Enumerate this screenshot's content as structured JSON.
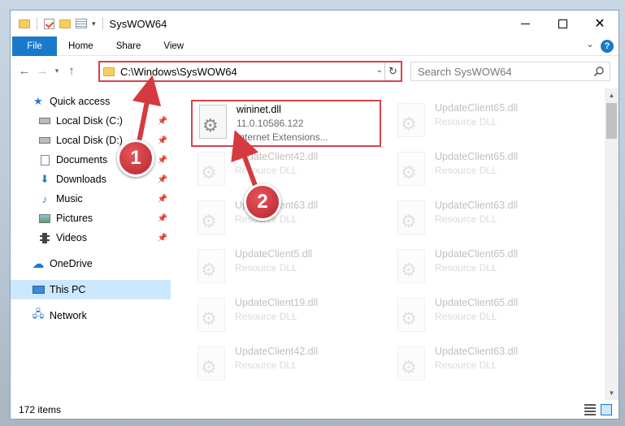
{
  "window": {
    "title": "SysWOW64"
  },
  "ribbon": {
    "tabs": [
      "File",
      "Home",
      "Share",
      "View"
    ]
  },
  "address": {
    "path": "C:\\Windows\\SysWOW64"
  },
  "search": {
    "placeholder": "Search SysWOW64"
  },
  "sidebar": {
    "items": [
      {
        "label": "Quick access",
        "icon": "star-icon"
      },
      {
        "label": "Local Disk (C:)",
        "icon": "drive-icon"
      },
      {
        "label": "Local Disk (D:)",
        "icon": "drive-icon"
      },
      {
        "label": "Documents",
        "icon": "documents-icon"
      },
      {
        "label": "Downloads",
        "icon": "download-icon"
      },
      {
        "label": "Music",
        "icon": "music-icon"
      },
      {
        "label": "Pictures",
        "icon": "pictures-icon"
      },
      {
        "label": "Videos",
        "icon": "videos-icon"
      },
      {
        "label": "OneDrive",
        "icon": "cloud-icon"
      },
      {
        "label": "This PC",
        "icon": "computer-icon"
      },
      {
        "label": "Network",
        "icon": "network-icon"
      }
    ]
  },
  "files": [
    {
      "name": "wininet.dll",
      "version": "11.0.10586.122",
      "type": "Internet Extensions...",
      "highlighted": true
    },
    {
      "name": "UpdateClient65.dll",
      "type": "Resource DLL"
    },
    {
      "name": "UpdateClient42.dll",
      "type": "Resource DLL"
    },
    {
      "name": "UpdateClient65.dll",
      "type": "Resource DLL"
    },
    {
      "name": "UpdateClient63.dll",
      "type": "Resource DLL"
    },
    {
      "name": "UpdateClient63.dll",
      "type": "Resource DLL"
    },
    {
      "name": "UpdateClient5.dll",
      "type": "Resource DLL"
    },
    {
      "name": "UpdateClient65.dll",
      "type": "Resource DLL"
    },
    {
      "name": "UpdateClient19.dll",
      "type": "Resource DLL"
    },
    {
      "name": "UpdateClient65.dll",
      "type": "Resource DLL"
    },
    {
      "name": "UpdateClient42.dll",
      "type": "Resource DLL"
    },
    {
      "name": "UpdateClient63.dll",
      "type": "Resource DLL"
    }
  ],
  "status": {
    "item_count": "172 items"
  },
  "annotations": [
    {
      "label": "1"
    },
    {
      "label": "2"
    }
  ],
  "colors": {
    "accent": "#1979ca",
    "highlight": "#d9434a",
    "selected": "#cce8ff"
  }
}
